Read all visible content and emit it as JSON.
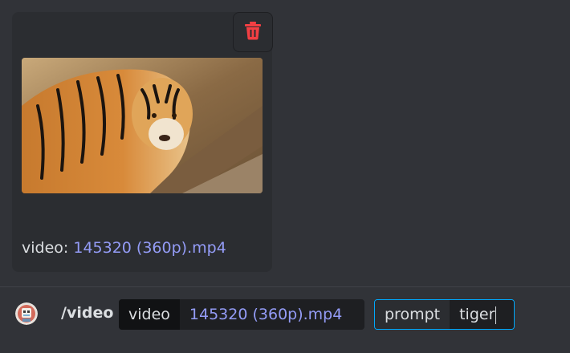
{
  "attachment": {
    "label": "video:",
    "filename": "145320 (360p).mp4"
  },
  "command": {
    "name": "/video",
    "options": {
      "video": {
        "key": "video",
        "value": "145320 (360p).mp4"
      },
      "prompt": {
        "key": "prompt",
        "value": "tiger"
      }
    }
  },
  "icons": {
    "delete": "trash-icon",
    "avatar": "bot-avatar-icon"
  },
  "colors": {
    "background": "#313338",
    "card": "#2b2d31",
    "link": "#949cf7",
    "danger": "#f23f43",
    "focus": "#00a8fc"
  }
}
